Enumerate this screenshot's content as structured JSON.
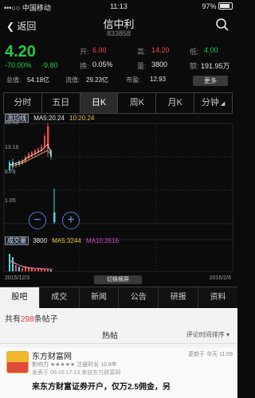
{
  "status_bar": {
    "signal": "•••○○ 中国移动 ",
    "wifi": "≋",
    "time": "11:13",
    "battery_pct": "97%"
  },
  "nav": {
    "back_label": "返回",
    "title": "信中利",
    "code": "833858"
  },
  "quote": {
    "price": "4.20",
    "change_pct": "-70.00%",
    "change": "-9.80",
    "open_label": "开:",
    "open": "6.00",
    "high_label": "高:",
    "high": "14.20",
    "low_label": "低:",
    "low": "4.00",
    "turnover_label": "换:",
    "turnover": "0.05%",
    "volume_label": "量:",
    "volume": "3800",
    "amount_label": "额:",
    "amount": "191.95万",
    "total_cap_label": "总值:",
    "total_cap": "54.18亿",
    "float_cap_label": "流值:",
    "float_cap": "29.23亿",
    "pe_label": "市盈:",
    "pe": "12.93",
    "more_label": "更多"
  },
  "period_tabs": [
    "分时",
    "五日",
    "日K",
    "周K",
    "月K",
    "分钟"
  ],
  "chart": {
    "legend_tag": "涨均线",
    "ma_text": "MA5:20.24",
    "ma_text2": "10:20.24",
    "y_ticks": [
      "20.50",
      "13.16",
      "8.78",
      "1.05"
    ],
    "vol_tag": "成交量",
    "vol_value": "3800",
    "vol_ma5": "MA5:3244",
    "vol_ma10": "MA10:2616",
    "x_start": "2015/12/3",
    "x_end": "2016/2/6",
    "switch_label": "切换横屏"
  },
  "chart_data": {
    "type": "candlestick",
    "y_ticks": [
      "20.50",
      "13.16",
      "8.78",
      "1.05"
    ],
    "x_start": "2015/12/3",
    "x_end": "2016/2/6",
    "ma5": "20.24",
    "ma10": "20.24",
    "volume": "3800",
    "vol_ma5": "3244",
    "vol_ma10": "2616"
  },
  "bottom_tabs": [
    "股吧",
    "成交",
    "新闻",
    "公告",
    "研报",
    "资料"
  ],
  "forum": {
    "count_prefix": "共有",
    "count": "298",
    "count_suffix": "条帖子",
    "hot_tab": "热帖",
    "sort_label": "评论时间排序 ▾",
    "post": {
      "author": "东方财富网",
      "meta": "影响力 ★★★★★ 注册时长 10.8年",
      "meta2": "发表于 06-16 17:13 来自东方财富网",
      "time": "更新于 今天 11:09",
      "title": "来东方财富证券开户，仅万2.5佣金，另"
    }
  }
}
